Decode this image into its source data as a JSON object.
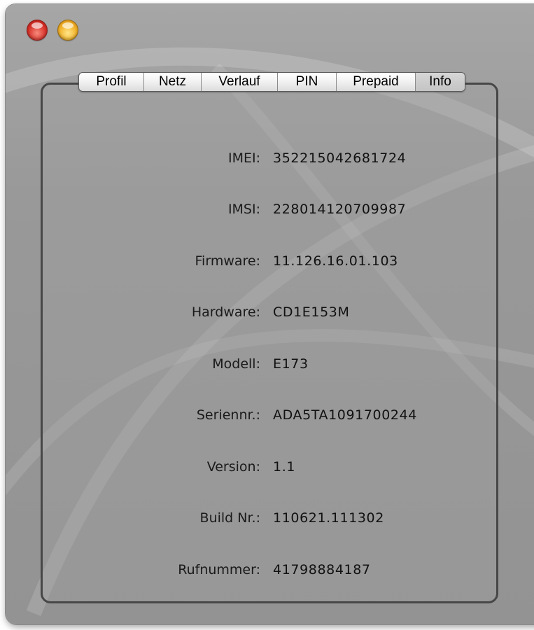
{
  "window": {
    "controls": [
      {
        "name": "close",
        "icon": "close-icon",
        "color": "#d9322a"
      },
      {
        "name": "minimize",
        "icon": "minimize-icon",
        "color": "#f2b228"
      }
    ]
  },
  "tabs": [
    {
      "label": "Profil",
      "active": false
    },
    {
      "label": "Netz",
      "active": false
    },
    {
      "label": "Verlauf",
      "active": false
    },
    {
      "label": "PIN",
      "active": false
    },
    {
      "label": "Prepaid",
      "active": false
    },
    {
      "label": "Info",
      "active": true
    }
  ],
  "info": {
    "imei": {
      "label": "IMEI:",
      "value": "352215042681724"
    },
    "imsi": {
      "label": "IMSI:",
      "value": "228014120709987"
    },
    "firmware": {
      "label": "Firmware:",
      "value": "11.126.16.01.103"
    },
    "hardware": {
      "label": "Hardware:",
      "value": "CD1E153M"
    },
    "modell": {
      "label": "Modell:",
      "value": "E173"
    },
    "seriennr": {
      "label": "Seriennr.:",
      "value": "ADA5TA1091700244"
    },
    "version": {
      "label": "Version:",
      "value": "1.1"
    },
    "build": {
      "label": "Build Nr.:",
      "value": "110621.111302"
    },
    "rufnummer": {
      "label": "Rufnummer:",
      "value": "41798884187"
    }
  }
}
